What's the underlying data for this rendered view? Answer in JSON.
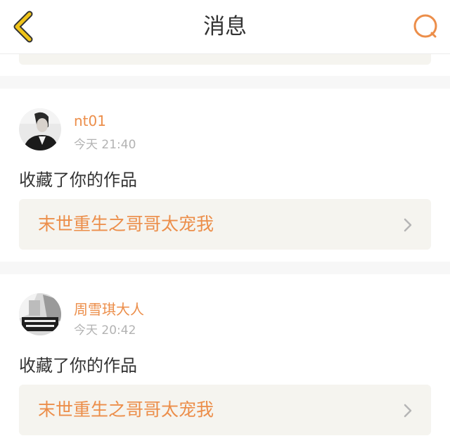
{
  "header": {
    "title": "消息",
    "back_icon": "chevron-left-icon",
    "search_icon": "search-icon"
  },
  "colors": {
    "accent": "#ec8e4a",
    "back_arrow": "#f0c419",
    "work_box_bg": "#f5f4ef"
  },
  "messages": [
    {
      "username": "nt01",
      "time": "今天 21:40",
      "action": "收藏了你的作品",
      "work_title": "末世重生之哥哥太宠我"
    },
    {
      "username": "周雪琪大人",
      "time": "今天 20:42",
      "action": "收藏了你的作品",
      "work_title": "末世重生之哥哥太宠我"
    }
  ]
}
